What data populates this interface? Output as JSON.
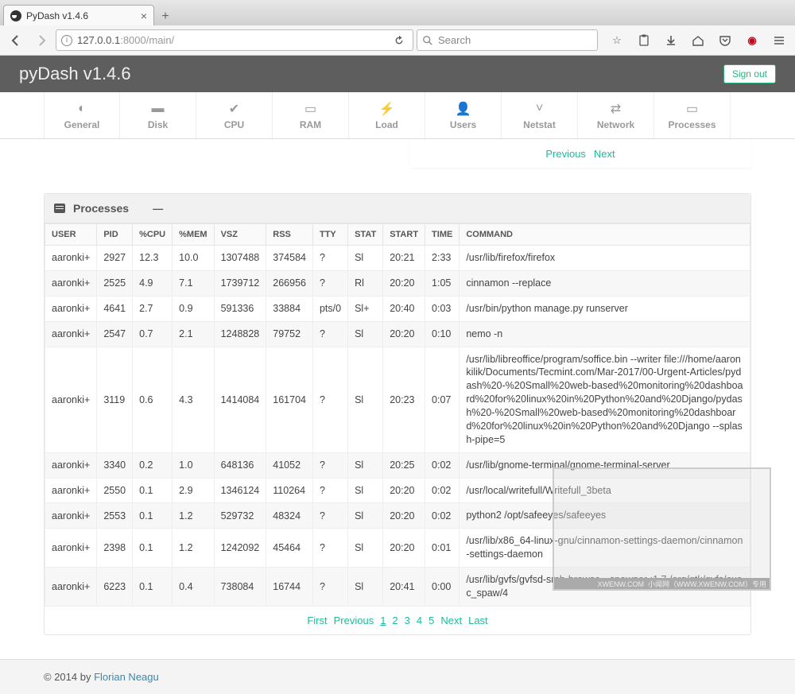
{
  "browser": {
    "tab_title": "PyDash v1.4.6",
    "url_host": "127.0.0.1",
    "url_port": ":8000",
    "url_path": "/main/",
    "search_placeholder": "Search"
  },
  "header": {
    "title": "pyDash v1.4.6",
    "signout": "Sign out"
  },
  "nav": [
    {
      "label": "General",
      "icon": "dashboard-icon"
    },
    {
      "label": "Disk",
      "icon": "disk-icon"
    },
    {
      "label": "CPU",
      "icon": "check-icon"
    },
    {
      "label": "RAM",
      "icon": "card-icon"
    },
    {
      "label": "Load",
      "icon": "bolt-icon"
    },
    {
      "label": "Users",
      "icon": "user-icon"
    },
    {
      "label": "Netstat",
      "icon": "chevron-down-icon"
    },
    {
      "label": "Network",
      "icon": "swap-icon"
    },
    {
      "label": "Processes",
      "icon": "card-icon"
    }
  ],
  "top_pager": {
    "previous": "Previous",
    "next": "Next"
  },
  "panel": {
    "title": "Processes",
    "columns": [
      "USER",
      "PID",
      "%CPU",
      "%MEM",
      "VSZ",
      "RSS",
      "TTY",
      "STAT",
      "START",
      "TIME",
      "COMMAND"
    ],
    "rows": [
      {
        "user": "aaronki+",
        "pid": "2927",
        "cpu": "12.3",
        "mem": "10.0",
        "vsz": "1307488",
        "rss": "374584",
        "tty": "?",
        "stat": "Sl",
        "start": "20:21",
        "time": "2:33",
        "cmd": "/usr/lib/firefox/firefox"
      },
      {
        "user": "aaronki+",
        "pid": "2525",
        "cpu": "4.9",
        "mem": "7.1",
        "vsz": "1739712",
        "rss": "266956",
        "tty": "?",
        "stat": "Rl",
        "start": "20:20",
        "time": "1:05",
        "cmd": "cinnamon --replace"
      },
      {
        "user": "aaronki+",
        "pid": "4641",
        "cpu": "2.7",
        "mem": "0.9",
        "vsz": "591336",
        "rss": "33884",
        "tty": "pts/0",
        "stat": "Sl+",
        "start": "20:40",
        "time": "0:03",
        "cmd": "/usr/bin/python manage.py runserver"
      },
      {
        "user": "aaronki+",
        "pid": "2547",
        "cpu": "0.7",
        "mem": "2.1",
        "vsz": "1248828",
        "rss": "79752",
        "tty": "?",
        "stat": "Sl",
        "start": "20:20",
        "time": "0:10",
        "cmd": "nemo -n"
      },
      {
        "user": "aaronki+",
        "pid": "3119",
        "cpu": "0.6",
        "mem": "4.3",
        "vsz": "1414084",
        "rss": "161704",
        "tty": "?",
        "stat": "Sl",
        "start": "20:23",
        "time": "0:07",
        "cmd": "/usr/lib/libreoffice/program/soffice.bin --writer file:///home/aaronkilik/Documents/Tecmint.com/Mar-2017/00-Urgent-Articles/pydash%20-%20Small%20web-based%20monitoring%20dashboard%20for%20linux%20in%20Python%20and%20Django/pydash%20-%20Small%20web-based%20monitoring%20dashboard%20for%20linux%20in%20Python%20and%20Django --splash-pipe=5"
      },
      {
        "user": "aaronki+",
        "pid": "3340",
        "cpu": "0.2",
        "mem": "1.0",
        "vsz": "648136",
        "rss": "41052",
        "tty": "?",
        "stat": "Sl",
        "start": "20:25",
        "time": "0:02",
        "cmd": "/usr/lib/gnome-terminal/gnome-terminal-server"
      },
      {
        "user": "aaronki+",
        "pid": "2550",
        "cpu": "0.1",
        "mem": "2.9",
        "vsz": "1346124",
        "rss": "110264",
        "tty": "?",
        "stat": "Sl",
        "start": "20:20",
        "time": "0:02",
        "cmd": "/usr/local/writefull/Writefull_3beta"
      },
      {
        "user": "aaronki+",
        "pid": "2553",
        "cpu": "0.1",
        "mem": "1.2",
        "vsz": "529732",
        "rss": "48324",
        "tty": "?",
        "stat": "Sl",
        "start": "20:20",
        "time": "0:02",
        "cmd": "python2 /opt/safeeyes/safeeyes"
      },
      {
        "user": "aaronki+",
        "pid": "2398",
        "cpu": "0.1",
        "mem": "1.2",
        "vsz": "1242092",
        "rss": "45464",
        "tty": "?",
        "stat": "Sl",
        "start": "20:20",
        "time": "0:01",
        "cmd": "/usr/lib/x86_64-linux-gnu/cinnamon-settings-daemon/cinnamon-settings-daemon"
      },
      {
        "user": "aaronki+",
        "pid": "6223",
        "cpu": "0.1",
        "mem": "0.4",
        "vsz": "738084",
        "rss": "16744",
        "tty": "?",
        "stat": "Sl",
        "start": "20:41",
        "time": "0:00",
        "cmd": "/usr/lib/gvfs/gvfsd-smb-browse --spawner :1.7 /org/gtk/gvfs/exec_spaw/4"
      }
    ]
  },
  "pager": {
    "first": "First",
    "previous": "Previous",
    "pages": [
      "1",
      "2",
      "3",
      "4",
      "5"
    ],
    "current": "1",
    "next": "Next",
    "last": "Last"
  },
  "footer": {
    "prefix": "© 2014 by ",
    "author": "Florian Neagu"
  },
  "watermark": {
    "text": "XWENW.COM",
    "sub": "小闻网（WWW.XWENW.COM）专用"
  }
}
